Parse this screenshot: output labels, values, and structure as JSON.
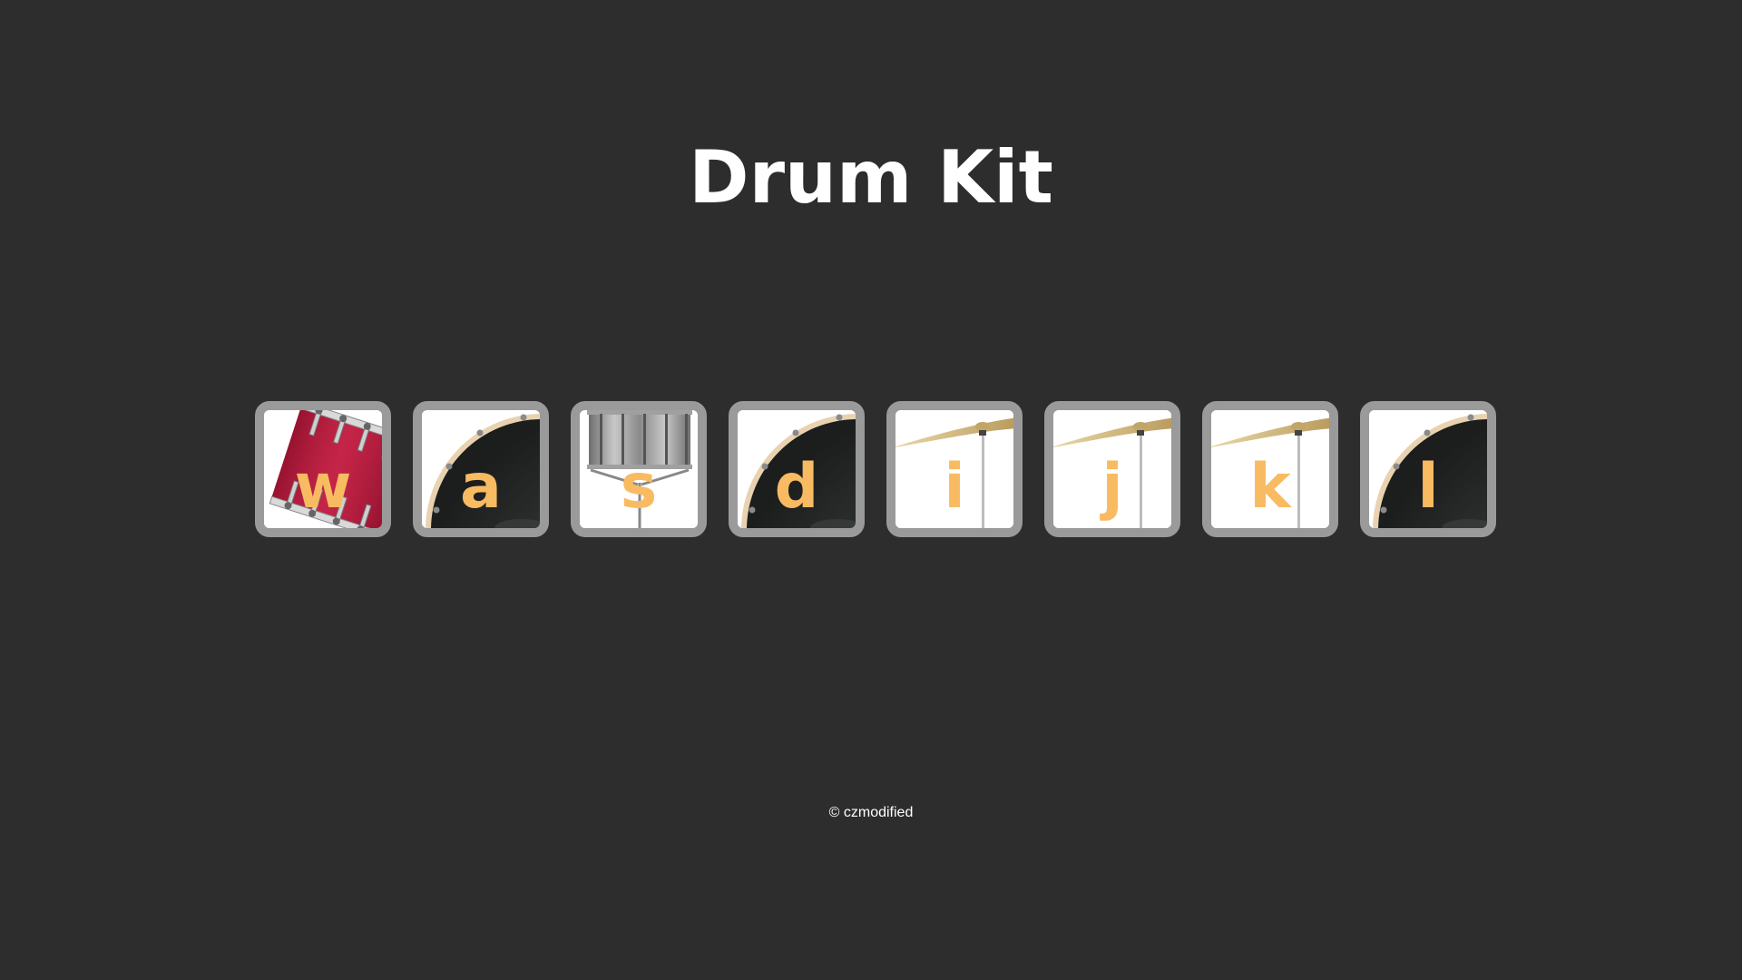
{
  "page": {
    "title": "Drum Kit",
    "footer": "© czmodified"
  },
  "drums": [
    {
      "key": "w",
      "instrument": "bass-drum-icon"
    },
    {
      "key": "a",
      "instrument": "floor-tom-icon"
    },
    {
      "key": "s",
      "instrument": "snare-drum-icon"
    },
    {
      "key": "d",
      "instrument": "floor-tom-icon"
    },
    {
      "key": "i",
      "instrument": "cymbal-icon"
    },
    {
      "key": "j",
      "instrument": "cymbal-icon"
    },
    {
      "key": "k",
      "instrument": "cymbal-icon"
    },
    {
      "key": "l",
      "instrument": "floor-tom-icon"
    }
  ],
  "colors": {
    "background": "#2d2d2d",
    "key_letter": "#f8bb62",
    "pad_border": "#9a9a9a",
    "title": "#ffffff"
  }
}
